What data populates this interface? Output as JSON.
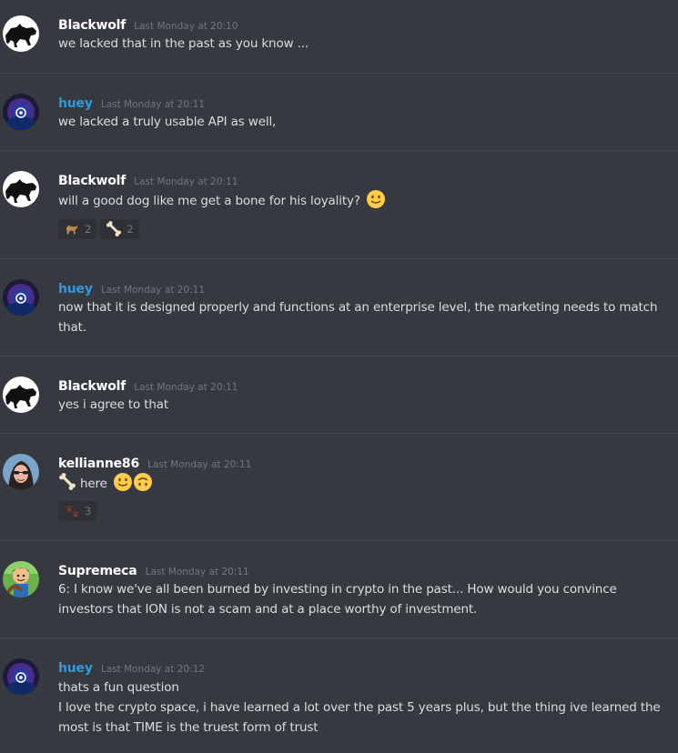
{
  "colors": {
    "background": "#36393f",
    "divider": "#42454a",
    "timestamp": "#72767d",
    "name_blackwolf": "#ffffff",
    "name_huey": "#3498db",
    "name_kellianne": "#ffffff",
    "name_supremeca": "#ffffff"
  },
  "messages": [
    {
      "user": "Blackwolf",
      "avatar": "black-wolf-avatar",
      "timestamp": "Last Monday at 20:10",
      "text": "we lacked that in the past as you know ..."
    },
    {
      "user": "huey",
      "avatar": "purple-orb-avatar",
      "timestamp": "Last Monday at 20:11",
      "text": "we lacked a truly usable API as well,"
    },
    {
      "user": "Blackwolf",
      "avatar": "black-wolf-avatar",
      "timestamp": "Last Monday at 20:11",
      "text": "will a good dog like me get a bone for his loyality?",
      "trailing_emoji": "slightly-smiling-face",
      "reactions": [
        {
          "icon": "dog-icon",
          "count": "2"
        },
        {
          "icon": "bone-icon",
          "count": "2"
        }
      ]
    },
    {
      "user": "huey",
      "avatar": "purple-orb-avatar",
      "timestamp": "Last Monday at 20:11",
      "text_line1": "now that it is designed properly and functions at an enterprise level, the marketing needs to match",
      "text_line2": "that."
    },
    {
      "user": "Blackwolf",
      "avatar": "black-wolf-avatar",
      "timestamp": "Last Monday at 20:11",
      "text": "yes i agree to that"
    },
    {
      "user": "kellianne86",
      "avatar": "woman-portrait-avatar",
      "timestamp": "Last Monday at 20:11",
      "leading_icon": "bone-icon",
      "text": "here",
      "trailing_emojis": [
        "slightly-smiling-face",
        "upside-down-face"
      ],
      "reactions": [
        {
          "icon": "paw-prints-icon",
          "count": "3"
        }
      ]
    },
    {
      "user": "Supremeca",
      "avatar": "cartoon-character-avatar",
      "timestamp": "Last Monday at 20:11",
      "text_line1": "6: I know we've all been burned by investing in crypto in the past... How would you convince",
      "text_line2": "investors that ION is not a scam and at a place worthy of investment."
    },
    {
      "user": "huey",
      "avatar": "purple-orb-avatar",
      "timestamp": "Last Monday at 20:12",
      "text_line1": "thats a fun question",
      "text_line2": "I love the crypto space, i have learned a lot over the past 5 years plus, but the thing ive learned the",
      "text_line3": "most is that TIME is the truest form of trust"
    }
  ]
}
